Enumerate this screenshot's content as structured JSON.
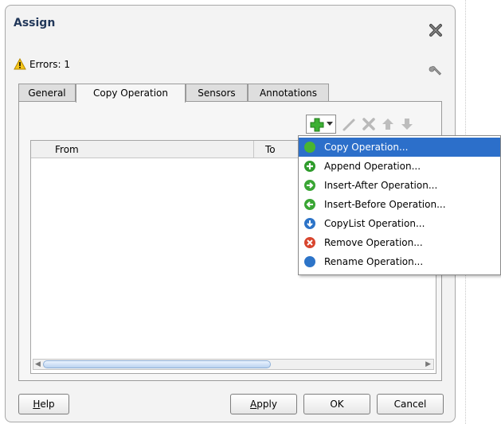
{
  "dialog": {
    "title": "Assign",
    "errors_label": "Errors: 1"
  },
  "tabs": [
    {
      "label": "General",
      "active": false
    },
    {
      "label": "Copy Operation",
      "active": true
    },
    {
      "label": "Sensors",
      "active": false
    },
    {
      "label": "Annotations",
      "active": false
    }
  ],
  "table": {
    "columns": [
      "From",
      "To"
    ]
  },
  "menu": {
    "items": [
      {
        "label": "Copy Operation...",
        "selected": true,
        "icon": "green-circle-icon",
        "color": "#49b531"
      },
      {
        "label": "Append Operation...",
        "selected": false,
        "icon": "plus-circle-icon",
        "color": "#2f9c2c"
      },
      {
        "label": "Insert-After Operation...",
        "selected": false,
        "icon": "arrow-right-circle-icon",
        "color": "#3aa635"
      },
      {
        "label": "Insert-Before Operation...",
        "selected": false,
        "icon": "arrow-left-circle-icon",
        "color": "#3aa635"
      },
      {
        "label": "CopyList Operation...",
        "selected": false,
        "icon": "arrow-down-circle-icon",
        "color": "#2d74c8"
      },
      {
        "label": "Remove Operation...",
        "selected": false,
        "icon": "x-circle-icon",
        "color": "#d8452e"
      },
      {
        "label": "Rename Operation...",
        "selected": false,
        "icon": "blue-circle-icon",
        "color": "#2d74c8"
      }
    ]
  },
  "buttons": {
    "help": {
      "mnemonic": "H",
      "rest": "elp"
    },
    "apply": {
      "mnemonic": "A",
      "rest": "pply"
    },
    "ok": "OK",
    "cancel": "Cancel"
  },
  "colors": {
    "selection": "#2c6fca",
    "title": "#22385a"
  }
}
